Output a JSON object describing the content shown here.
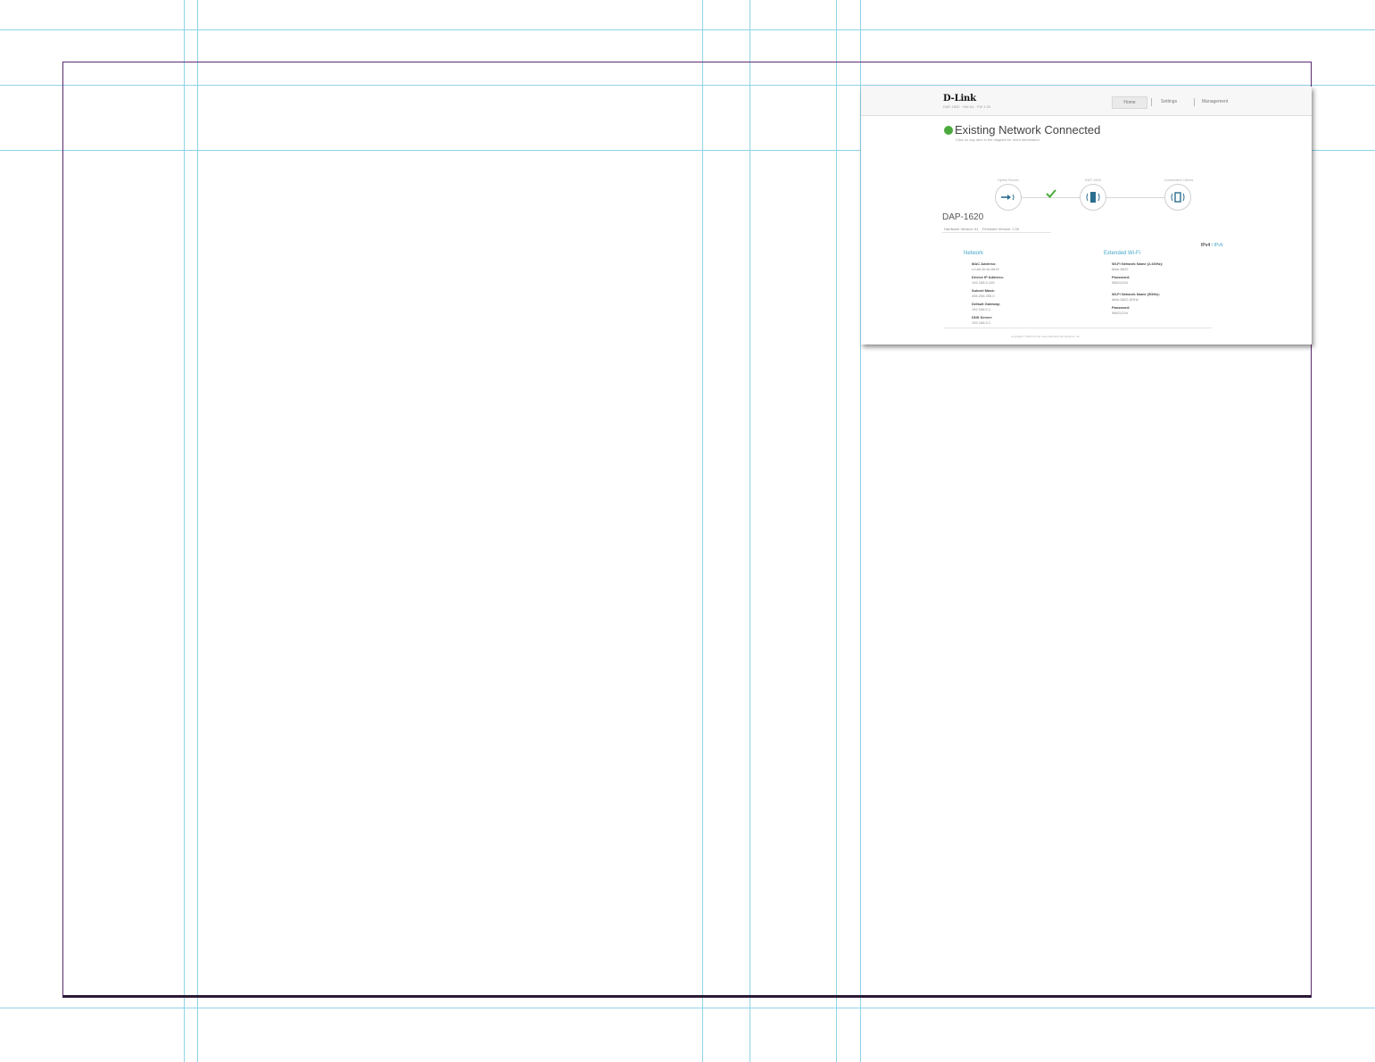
{
  "header": {
    "brand": "D-Link",
    "brand_sub": "DAP-1620 · HW A1 · FW 1.00",
    "nav": {
      "home": "Home",
      "settings": "Settings",
      "management": "Management"
    }
  },
  "status": {
    "title": "Existing Network Connected",
    "subtitle": "Click on any item in the diagram for more information.",
    "color": "#4caa3c"
  },
  "diagram": {
    "nodes": [
      {
        "label": "Uplink Router",
        "icon": "router-uplink-icon"
      },
      {
        "label": "DAP-1620",
        "icon": "extender-icon"
      },
      {
        "label": "Connected Clients",
        "icon": "clients-icon"
      }
    ],
    "link_status_icon": "checkmark-icon"
  },
  "device": {
    "name": "DAP-1620",
    "hardware_version": "Hardware Version: A1",
    "firmware_version": "Firmware Version: 1.00"
  },
  "ip_toggle": {
    "ipv4": "IPv4",
    "separator": "/",
    "ipv6": "IPv6"
  },
  "network": {
    "heading": "Network",
    "fields": [
      {
        "label": "MAC Address:",
        "value": "c1:a8:1b:6c:06:f0"
      },
      {
        "label": "Device IP Address:",
        "value": "192.168.0.105"
      },
      {
        "label": "Subnet Mask:",
        "value": "255.255.255.0"
      },
      {
        "label": "Default Gateway:",
        "value": "192.168.0.1"
      },
      {
        "label": "DNS Server:",
        "value": "192.168.0.1"
      }
    ]
  },
  "wifi": {
    "heading": "Extended Wi-Fi",
    "fields": [
      {
        "label": "Wi-Fi Network Name (2.4GHz):",
        "value": "dlink-5622"
      },
      {
        "label": "Password:",
        "value": "98621234"
      },
      {
        "label": "Wi-Fi Network Name (5GHz):",
        "value": "dlink-5622-5GHz"
      },
      {
        "label": "Password:",
        "value": "98621234"
      }
    ]
  },
  "footer": {
    "copyright": "Copyright © 2015 D-Link Corporation/D-Link Systems, Inc."
  },
  "colors": {
    "accent": "#45a6c9",
    "status_ok": "#4caa3c",
    "frame": "#5b2a6e"
  }
}
